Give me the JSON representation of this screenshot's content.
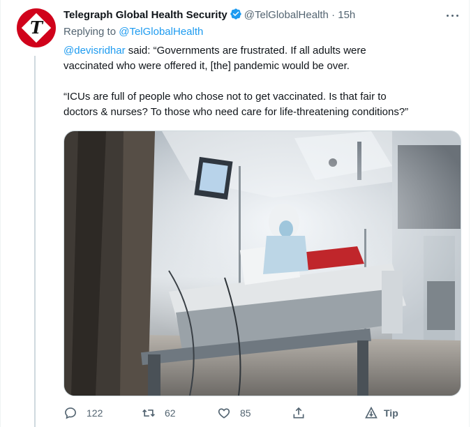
{
  "tweet": {
    "author_name": "Telegraph Global Health Security",
    "handle": "@TelGlobalHealth",
    "separator": "·",
    "time": "15h",
    "avatar_letter": "T",
    "reply_prefix": "Replying to",
    "reply_handle": "@TelGlobalHealth",
    "mention": "@devisridhar",
    "para1_line1_rest": " said: “Governments are frustrated. If all adults were",
    "para1_line2": "vaccinated who were offered it, [the] pandemic would be over.",
    "para2_line1": "“ICUs are full of people who chose not to get vaccinated. Is that fair to",
    "para2_line2": "doctors & nurses? To those who need care for life-threatening conditions?”"
  },
  "actions": {
    "replies": "122",
    "retweets": "62",
    "likes": "85",
    "tip": "Tip"
  },
  "icons": [
    "verified-badge-icon",
    "more-options-icon",
    "reply-icon",
    "retweet-icon",
    "like-icon",
    "share-icon",
    "tip-icon"
  ],
  "colors": {
    "link": "#1d9bf0",
    "secondary_text": "#536471",
    "avatar_red": "#d0021b",
    "text": "#0f1419"
  }
}
